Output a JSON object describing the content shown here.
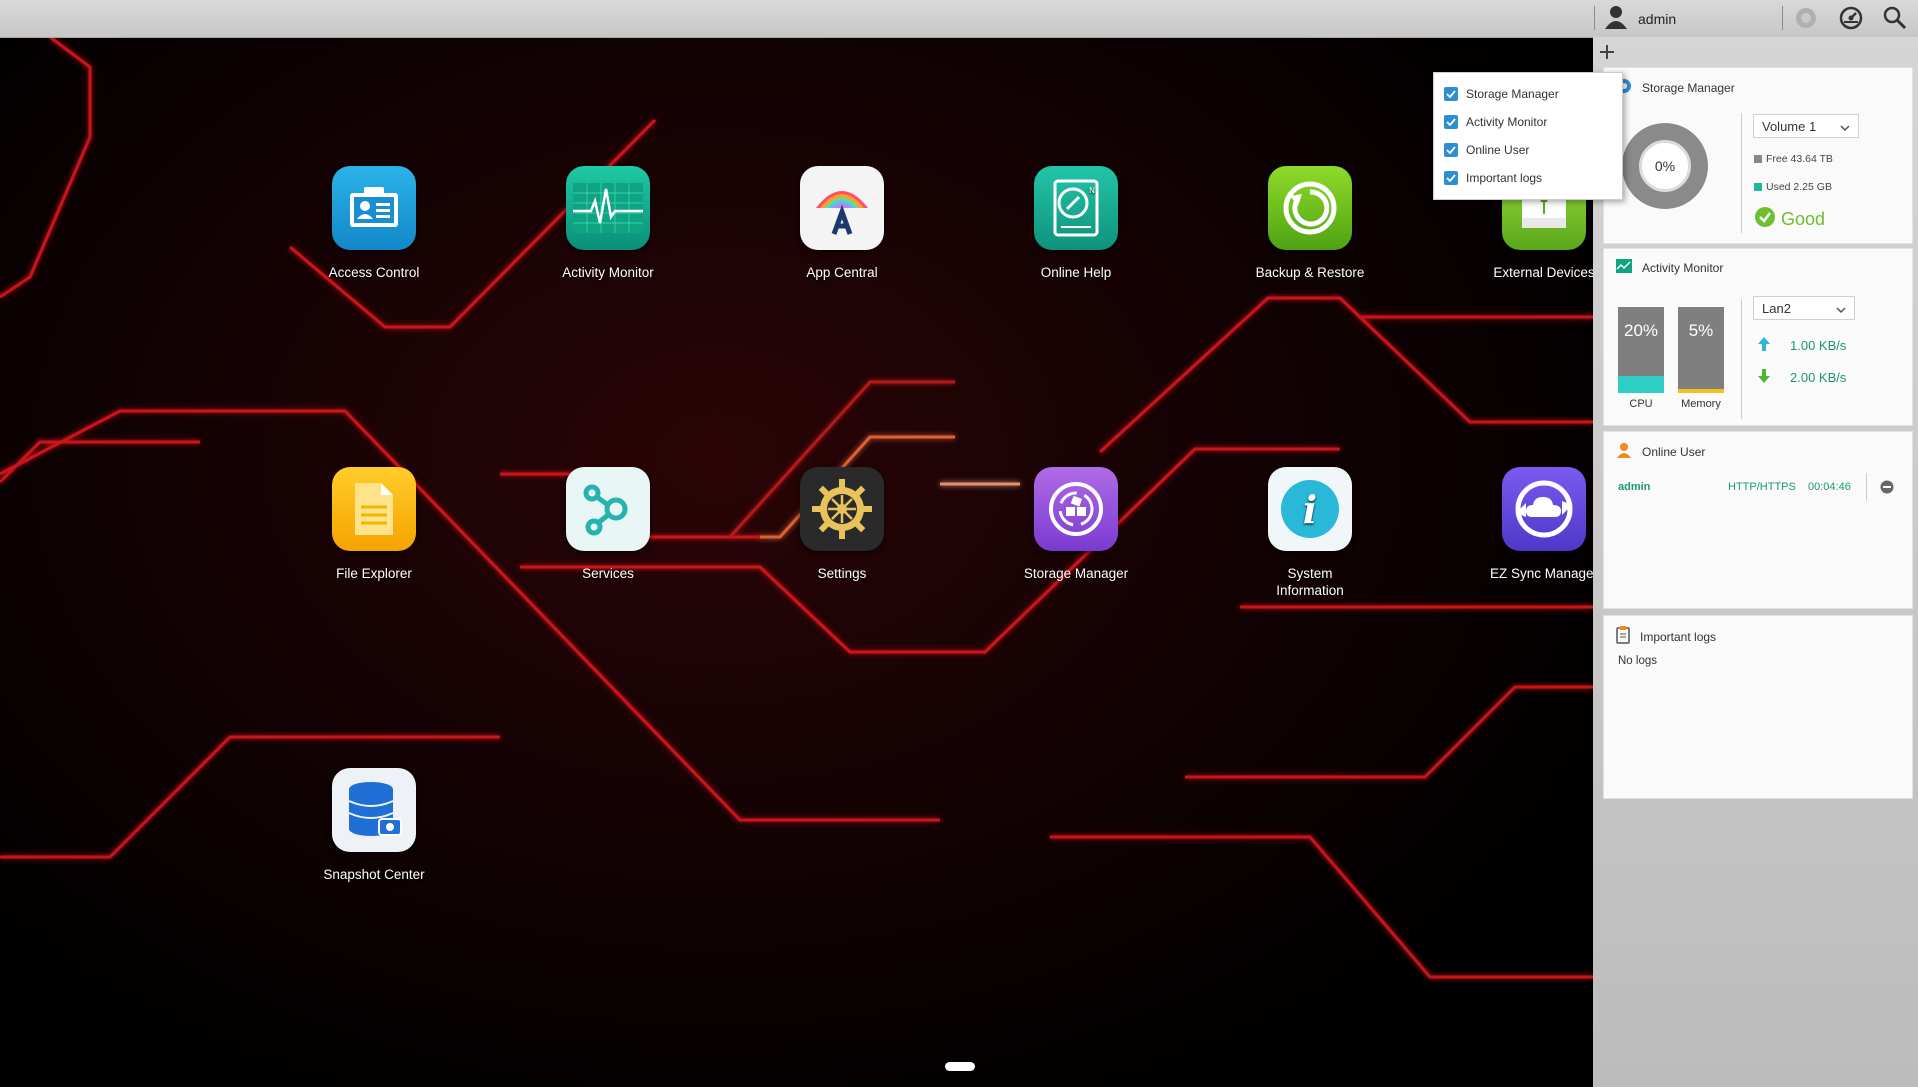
{
  "topbar": {
    "user_name": "admin",
    "icons": [
      "user-icon",
      "notification-icon",
      "dashboard-icon",
      "search-icon"
    ]
  },
  "desktop": {
    "apps": [
      {
        "name": "access-control",
        "label": "Access Control",
        "icon": "id-card-icon"
      },
      {
        "name": "activity-monitor",
        "label": "Activity Monitor",
        "icon": "heartbeat-icon"
      },
      {
        "name": "app-central",
        "label": "App Central",
        "icon": "app-central-logo-icon"
      },
      {
        "name": "online-help",
        "label": "Online Help",
        "icon": "compass-book-icon"
      },
      {
        "name": "backup-restore",
        "label": "Backup & Restore",
        "icon": "refresh-icon"
      },
      {
        "name": "external-devices",
        "label": "External Devices",
        "icon": "usb-drive-icon"
      },
      {
        "name": "file-explorer",
        "label": "File Explorer",
        "icon": "folder-icon"
      },
      {
        "name": "services",
        "label": "Services",
        "icon": "nodes-icon"
      },
      {
        "name": "settings",
        "label": "Settings",
        "icon": "gear-icon"
      },
      {
        "name": "storage-manager",
        "label": "Storage Manager",
        "icon": "storage-icon"
      },
      {
        "name": "system-information",
        "label": "System\nInformation",
        "icon": "info-icon"
      },
      {
        "name": "ez-sync-manager",
        "label": "EZ Sync Manager",
        "icon": "cloud-sync-icon"
      },
      {
        "name": "snapshot-center",
        "label": "Snapshot Center",
        "icon": "database-camera-icon"
      }
    ]
  },
  "widget_menu": {
    "items": [
      {
        "label": "Storage Manager",
        "checked": true
      },
      {
        "label": "Activity Monitor",
        "checked": true
      },
      {
        "label": "Online User",
        "checked": true
      },
      {
        "label": "Important logs",
        "checked": true
      }
    ]
  },
  "panel": {
    "storage": {
      "title": "Storage Manager",
      "volume": "Volume 1",
      "usage_percent": "0%",
      "free": "Free 43.64 TB",
      "used": "Used 2.25 GB",
      "status": "Good"
    },
    "activity": {
      "title": "Activity Monitor",
      "cpu_percent": "20%",
      "cpu_value": 0.2,
      "cpu_label": "CPU",
      "memory_percent": "5%",
      "memory_value": 0.05,
      "memory_label": "Memory",
      "interface": "Lan2",
      "upload": "1.00 KB/s",
      "download": "2.00 KB/s"
    },
    "online_user": {
      "title": "Online User",
      "user": "admin",
      "protocol": "HTTP/HTTPS",
      "duration": "00:04:46"
    },
    "logs": {
      "title": "Important logs",
      "empty": "No logs"
    }
  },
  "colors": {
    "accent_teal": "#2fcfc3",
    "memory_yellow": "#f0c419",
    "good_green": "#6dbf2e",
    "user_green": "#1a9a6e",
    "checkbox_blue": "#2c8fd4"
  }
}
